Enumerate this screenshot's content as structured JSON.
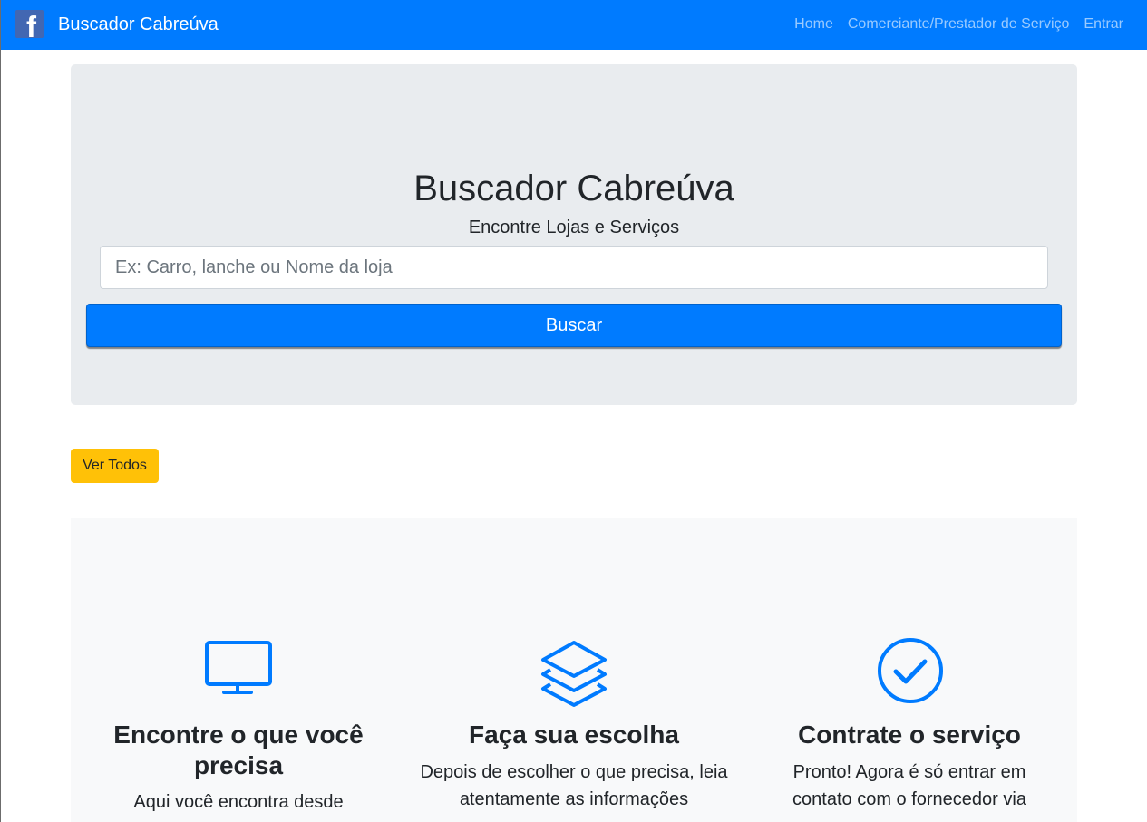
{
  "navbar": {
    "logo_letter": "f",
    "brand": "Buscador Cabreúva",
    "links": [
      "Home",
      "Comerciante/Prestador de Serviço",
      "Entrar"
    ],
    "bg_color": "#007bff"
  },
  "hero": {
    "title": "Buscador Cabreúva",
    "subtitle": "Encontre Lojas e Serviços",
    "search_placeholder": "Ex: Carro, lanche ou Nome da loja",
    "search_value": "",
    "search_button": "Buscar"
  },
  "ver_todos": "Ver Todos",
  "features": [
    {
      "icon": "monitor-icon",
      "title": "Encontre o que você precisa",
      "text": "Aqui você encontra desde"
    },
    {
      "icon": "layers-icon",
      "title": "Faça sua escolha",
      "text": "Depois de escolher o que precisa, leia atentamente as informações"
    },
    {
      "icon": "check-circle-icon",
      "title": "Contrate o serviço",
      "text": "Pronto! Agora é só entrar em contato com o fornecedor via"
    }
  ],
  "colors": {
    "primary": "#007bff",
    "warning": "#ffc107",
    "jumbotron": "#e9ecef",
    "light": "#f8f9fa"
  }
}
